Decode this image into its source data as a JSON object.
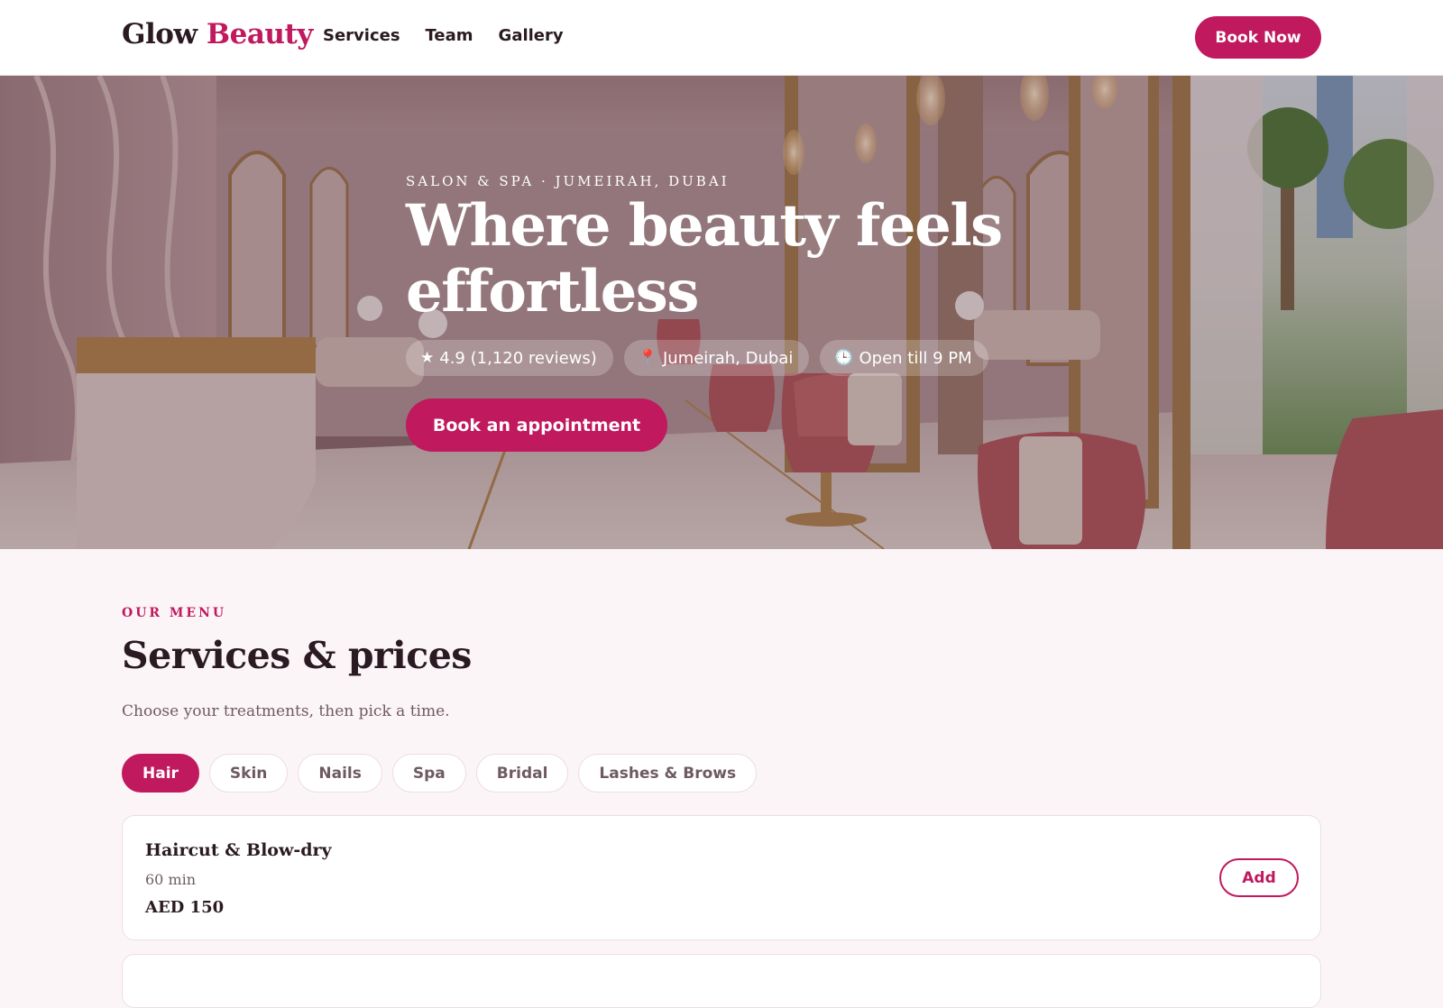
{
  "header": {
    "logo_part1": "Glow",
    "logo_part2": "Beauty",
    "nav": [
      "Services",
      "Team",
      "Gallery"
    ],
    "cta": "Book Now"
  },
  "hero": {
    "eyebrow": "SALON & SPA · JUMEIRAH, DUBAI",
    "title": "Where beauty feels effortless",
    "chips": [
      {
        "icon": "star-icon",
        "glyph": "★",
        "text": "4.9 (1,120 reviews)"
      },
      {
        "icon": "location-pin-icon",
        "glyph": "📍",
        "text": "Jumeirah, Dubai"
      },
      {
        "icon": "clock-icon",
        "glyph": "🕒",
        "text": "Open till 9 PM"
      }
    ],
    "cta": "Book an appointment"
  },
  "services": {
    "eyebrow": "OUR MENU",
    "title": "Services & prices",
    "subtitle": "Choose your treatments, then pick a time.",
    "tabs": [
      "Hair",
      "Skin",
      "Nails",
      "Spa",
      "Bridal",
      "Lashes & Brows"
    ],
    "active_tab": "Hair",
    "items": [
      {
        "name": "Haircut & Blow-dry",
        "duration": "60 min",
        "price": "AED 150",
        "action": "Add"
      }
    ]
  },
  "colors": {
    "accent": "#c0195e",
    "text": "#2a1a22",
    "muted": "#6e5a63",
    "page_bg": "#fcf5f7"
  }
}
